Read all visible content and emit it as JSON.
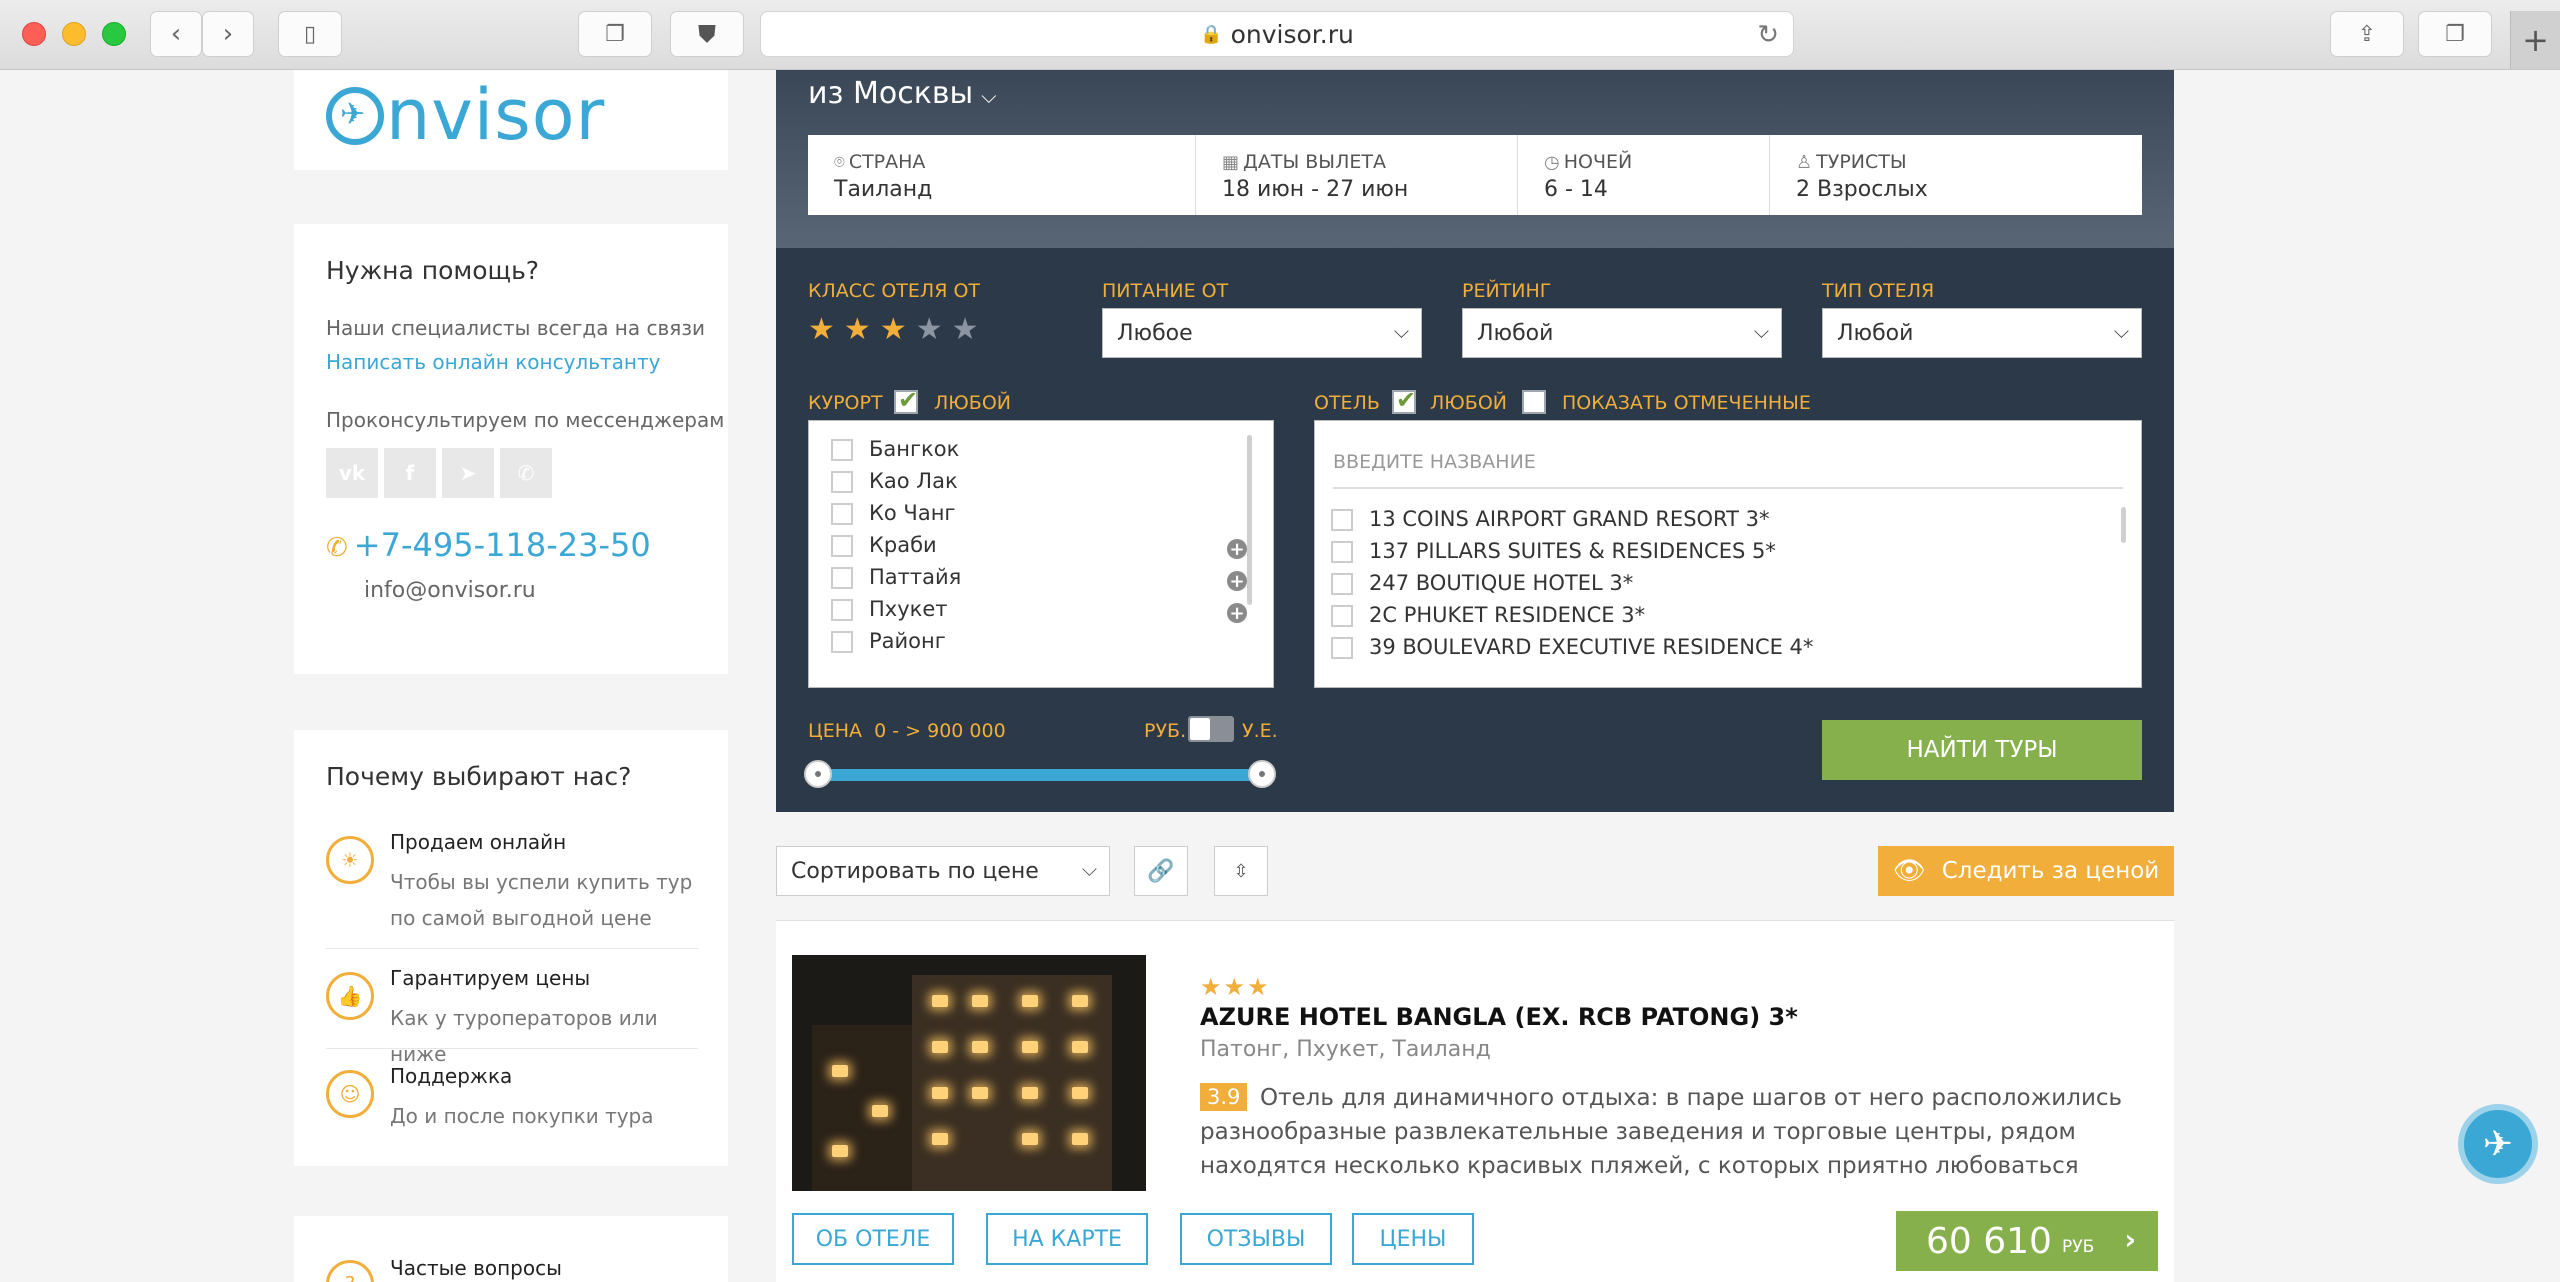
{
  "browser": {
    "url": "onvisor.ru"
  },
  "logo": {
    "text": "nvisor"
  },
  "help": {
    "title": "Нужна помощь?",
    "line1": "Наши специалисты всегда на связи",
    "link": "Написать онлайн консультанту",
    "line2": "Проконсультируем по мессенджерам",
    "messengers": [
      "vk-icon",
      "facebook-icon",
      "telegram-icon",
      "phone-icon"
    ],
    "phone": "+7-495-118-23-50",
    "email": "info@onvisor.ru"
  },
  "why": {
    "title": "Почему выбирают нас?",
    "items": [
      {
        "title": "Продаем онлайн",
        "desc": "Чтобы вы успели купить тур по самой выгодной цене"
      },
      {
        "title": "Гарантируем цены",
        "desc": "Как у туроператоров или ниже"
      },
      {
        "title": "Поддержка",
        "desc": "До и после покупки тура"
      }
    ]
  },
  "faq": {
    "title": "Частые вопросы"
  },
  "search": {
    "from": "из Москвы",
    "fields": [
      {
        "label": "СТРАНА",
        "value": "Таиланд",
        "icon": "location-icon"
      },
      {
        "label": "ДАТЫ ВЫЛЕТА",
        "value": "18 июн - 27 июн",
        "icon": "calendar-icon"
      },
      {
        "label": "НОЧЕЙ",
        "value": "6 - 14",
        "icon": "clock-icon"
      },
      {
        "label": "ТУРИСТЫ",
        "value": "2 Взрослых",
        "icon": "user-icon"
      }
    ],
    "hotel_class_label": "КЛАСС ОТЕЛЯ ОТ",
    "hotel_class_stars": 3,
    "hotel_class_max": 5,
    "food_label": "ПИТАНИЕ ОТ",
    "food_value": "Любое",
    "rating_label": "РЕЙТИНГ",
    "rating_value": "Любой",
    "type_label": "ТИП ОТЕЛЯ",
    "type_value": "Любой",
    "resort_label": "КУРОРТ",
    "resort_any": "ЛЮБОЙ",
    "resorts": [
      "Бангкок",
      "Као Лак",
      "Ко Чанг",
      "Краби",
      "Паттайя",
      "Пхукет",
      "Районг"
    ],
    "hotel_label": "ОТЕЛЬ",
    "hotel_any": "ЛЮБОЙ",
    "show_marked": "ПОКАЗАТЬ ОТМЕЧЕННЫЕ",
    "hotel_placeholder": "ВВЕДИТЕ НАЗВАНИЕ",
    "hotels": [
      "13 COINS AIRPORT GRAND RESORT 3*",
      "137 PILLARS SUITES & RESIDENCES 5*",
      "247 BOUTIQUE HOTEL 3*",
      "2C PHUKET RESIDENCE 3*",
      "39 BOULEVARD EXECUTIVE RESIDENCE 4*"
    ],
    "price_label": "ЦЕНА",
    "price_range": "0 -  > 900 000",
    "currency_rub": "РУБ.",
    "currency_ue": "У.Е.",
    "find_button": "НАЙТИ ТУРЫ"
  },
  "sort": {
    "value": "Сортировать по цене",
    "watch_button": "Следить за ценой"
  },
  "hotel_card": {
    "stars": "★★★",
    "name": "AZURE HOTEL BANGLA (EX. RCB PATONG) 3*",
    "location": "Патонг, Пхукет, Таиланд",
    "rating": "3.9",
    "description": "Отель для динамичного отдыха: в паре шагов от него расположились разнообразные развлекательные заведения и торговые центры, рядом находятся несколько красивых пляжей, с которых приятно любоваться романтическими",
    "buttons": [
      "ОБ ОТЕЛЕ",
      "НА КАРТЕ",
      "ОТЗЫВЫ",
      "ЦЕНЫ"
    ],
    "price": "60 610",
    "currency": "РУБ"
  },
  "colors": {
    "accent_blue": "#3ba7d4",
    "accent_orange": "#f1ae3a",
    "accent_green": "#86b04b",
    "panel": "#2c3948"
  }
}
